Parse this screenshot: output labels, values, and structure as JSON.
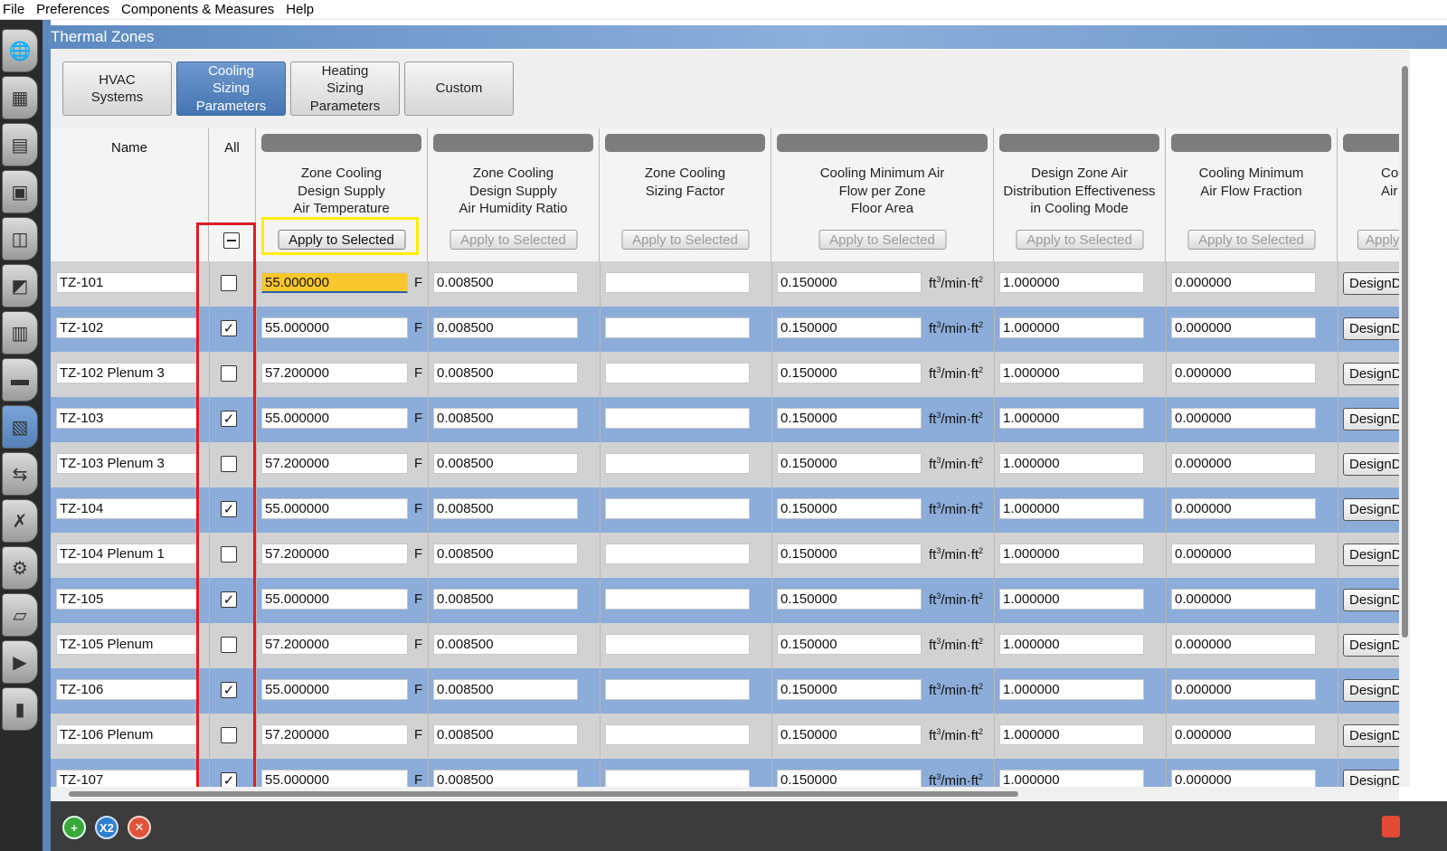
{
  "menubar": {
    "items": [
      "File",
      "Preferences",
      "Components & Measures",
      "Help"
    ]
  },
  "left_toolbar": {
    "icons": [
      "site-icon",
      "schedules-icon",
      "constructions-icon",
      "loads-icon",
      "space-types-icon",
      "geometry-icon",
      "facility-icon",
      "spaces-icon",
      "thermal-zones-icon",
      "hvac-systems-icon",
      "variables-icon",
      "simulation-settings-icon",
      "scripts-icon",
      "run-simulation-icon",
      "results-summary-icon"
    ],
    "active_index": 8
  },
  "title_bar": {
    "title": "Thermal Zones"
  },
  "tabs": [
    {
      "label": "HVAC\nSystems",
      "active": false
    },
    {
      "label": "Cooling\nSizing\nParameters",
      "active": true
    },
    {
      "label": "Heating\nSizing\nParameters",
      "active": false
    },
    {
      "label": "Custom",
      "active": false
    }
  ],
  "table": {
    "name_header": "Name",
    "all_header": "All",
    "apply_label": "Apply to Selected",
    "columns": [
      {
        "title": "Zone Cooling\nDesign Supply\nAir Temperature",
        "apply_enabled": true
      },
      {
        "title": "Zone Cooling\nDesign Supply\nAir Humidity Ratio",
        "apply_enabled": false
      },
      {
        "title": "Zone Cooling\nSizing Factor",
        "apply_enabled": false
      },
      {
        "title": "Cooling Minimum Air\nFlow per Zone\nFloor Area",
        "apply_enabled": false
      },
      {
        "title": "Design Zone Air\nDistribution Effectiveness\nin Cooling Mode",
        "apply_enabled": false
      },
      {
        "title": "Cooling Minimum\nAir Flow Fraction",
        "apply_enabled": false
      },
      {
        "title": "Coo\nAir F",
        "apply_enabled": false,
        "apply_label_partial": "Apply"
      }
    ],
    "units": {
      "temperature": "F",
      "flow_base": "ft",
      "flow_sup1": "3",
      "flow_mid": "/min·ft",
      "flow_sup2": "2"
    },
    "design_button_label": "DesignD",
    "rows": [
      {
        "name": "TZ-101",
        "checked": false,
        "temp": "55.000000",
        "humidity": "0.008500",
        "sizing_factor": "",
        "min_flow": "0.150000",
        "effectiveness": "1.000000",
        "flow_fraction": "0.000000",
        "selected_temp": true
      },
      {
        "name": "TZ-102",
        "checked": true,
        "temp": "55.000000",
        "humidity": "0.008500",
        "sizing_factor": "",
        "min_flow": "0.150000",
        "effectiveness": "1.000000",
        "flow_fraction": "0.000000"
      },
      {
        "name": "TZ-102 Plenum 3",
        "checked": false,
        "temp": "57.200000",
        "humidity": "0.008500",
        "sizing_factor": "",
        "min_flow": "0.150000",
        "effectiveness": "1.000000",
        "flow_fraction": "0.000000"
      },
      {
        "name": "TZ-103",
        "checked": true,
        "temp": "55.000000",
        "humidity": "0.008500",
        "sizing_factor": "",
        "min_flow": "0.150000",
        "effectiveness": "1.000000",
        "flow_fraction": "0.000000"
      },
      {
        "name": "TZ-103 Plenum 3",
        "checked": false,
        "temp": "57.200000",
        "humidity": "0.008500",
        "sizing_factor": "",
        "min_flow": "0.150000",
        "effectiveness": "1.000000",
        "flow_fraction": "0.000000"
      },
      {
        "name": "TZ-104",
        "checked": true,
        "temp": "55.000000",
        "humidity": "0.008500",
        "sizing_factor": "",
        "min_flow": "0.150000",
        "effectiveness": "1.000000",
        "flow_fraction": "0.000000"
      },
      {
        "name": "TZ-104 Plenum 1",
        "checked": false,
        "temp": "57.200000",
        "humidity": "0.008500",
        "sizing_factor": "",
        "min_flow": "0.150000",
        "effectiveness": "1.000000",
        "flow_fraction": "0.000000"
      },
      {
        "name": "TZ-105",
        "checked": true,
        "temp": "55.000000",
        "humidity": "0.008500",
        "sizing_factor": "",
        "min_flow": "0.150000",
        "effectiveness": "1.000000",
        "flow_fraction": "0.000000"
      },
      {
        "name": "TZ-105 Plenum",
        "checked": false,
        "temp": "57.200000",
        "humidity": "0.008500",
        "sizing_factor": "",
        "min_flow": "0.150000",
        "effectiveness": "1.000000",
        "flow_fraction": "0.000000"
      },
      {
        "name": "TZ-106",
        "checked": true,
        "temp": "55.000000",
        "humidity": "0.008500",
        "sizing_factor": "",
        "min_flow": "0.150000",
        "effectiveness": "1.000000",
        "flow_fraction": "0.000000"
      },
      {
        "name": "TZ-106 Plenum",
        "checked": false,
        "temp": "57.200000",
        "humidity": "0.008500",
        "sizing_factor": "",
        "min_flow": "0.150000",
        "effectiveness": "1.000000",
        "flow_fraction": "0.000000"
      },
      {
        "name": "TZ-107",
        "checked": true,
        "temp": "55.000000",
        "humidity": "0.008500",
        "sizing_factor": "",
        "min_flow": "0.150000",
        "effectiveness": "1.000000",
        "flow_fraction": "0.000000"
      }
    ]
  },
  "bottom_bar": {
    "add_label": "+",
    "copy_label": "X2",
    "delete_label": "✕",
    "icons": [
      "add-icon",
      "copy-icon",
      "delete-icon",
      "purge-icon"
    ]
  },
  "colors": {
    "row_odd": "#d2d2d2",
    "row_even": "#8cacd9",
    "active_tab": "#4575b2",
    "highlight_yellow": "#ffee00",
    "highlight_red": "#e01b24",
    "selected_cell": "#f9c72b"
  }
}
